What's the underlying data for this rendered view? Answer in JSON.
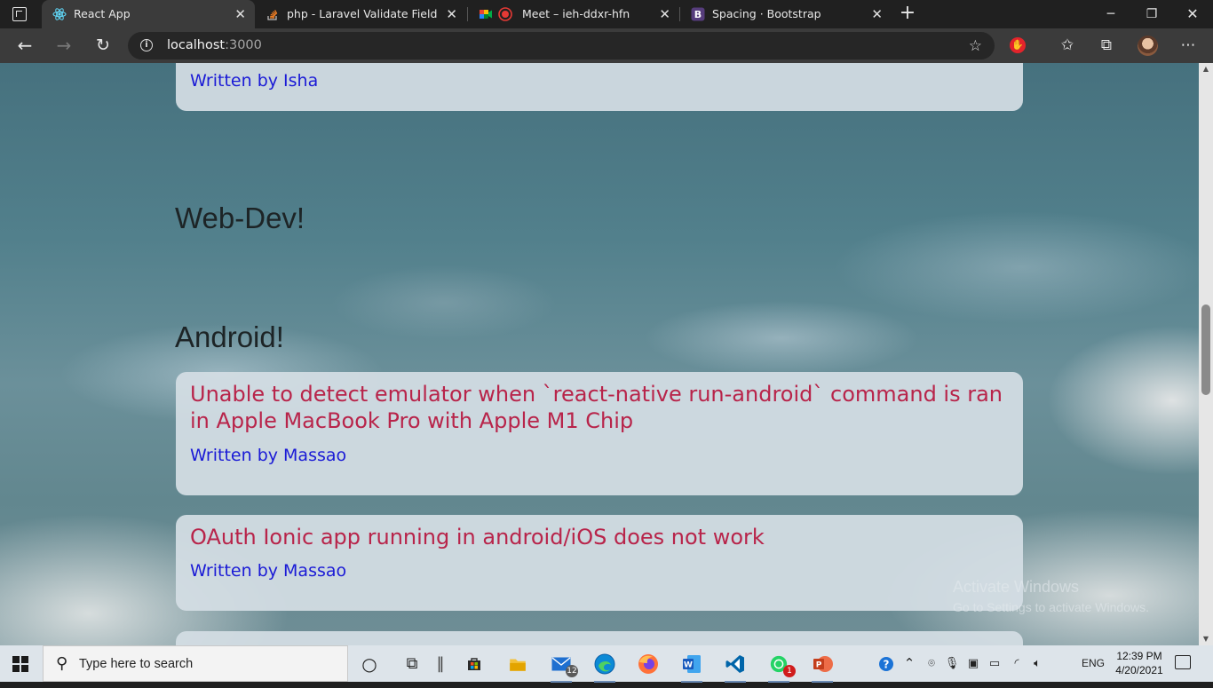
{
  "browser": {
    "tabs": [
      {
        "title": "React App",
        "favicon": "react-icon",
        "active": true
      },
      {
        "title": "php - Laravel Validate Field X if F",
        "favicon": "stackoverflow-icon",
        "active": false
      },
      {
        "title": "Meet – ieh-ddxr-hfn",
        "favicon": "google-meet-icon",
        "active": false
      },
      {
        "title": "Spacing · Bootstrap",
        "favicon": "bootstrap-icon",
        "active": false
      }
    ],
    "url_host": "localhost",
    "url_port": ":3000",
    "window_controls": [
      "minimize-icon",
      "restore-icon",
      "close-icon"
    ]
  },
  "page": {
    "top_card": {
      "author": "Written by Isha"
    },
    "sections": [
      {
        "heading": "Web-Dev!"
      },
      {
        "heading": "Android!"
      }
    ],
    "posts": [
      {
        "title": "Unable to detect emulator when `react-native run-android` command is ran in Apple MacBook Pro with Apple M1 Chip",
        "author": "Written by Massao"
      },
      {
        "title": "OAuth Ionic app running in android/iOS does not work",
        "author": "Written by Massao"
      }
    ],
    "watermark": {
      "line1": "Activate Windows",
      "line2": "Go to Settings to activate Windows."
    }
  },
  "taskbar": {
    "search_placeholder": "Type here to search",
    "mail_badge": "12",
    "whatsapp_badge": "1",
    "language": "ENG",
    "time": "12:39 PM",
    "date": "4/20/2021"
  },
  "colors": {
    "post_title": "#b8244a",
    "post_author": "#1a1ad6",
    "card_bg": "#d4dee4"
  }
}
